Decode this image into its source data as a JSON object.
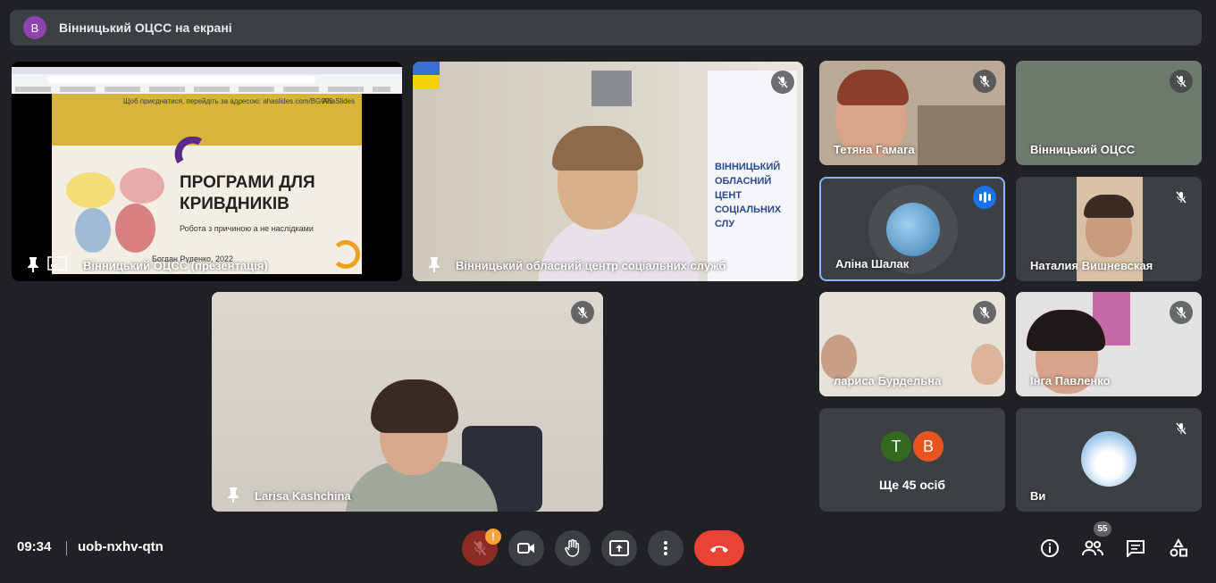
{
  "banner": {
    "avatar_letter": "В",
    "text": "Вінницький ОЦСС на екрані"
  },
  "presentation_tile": {
    "name": "Вінницький ОЦСС (презентація)",
    "slide": {
      "url_line": "Щоб приєднатися, перейдіть за адресою: ahaslides.com/BG995",
      "brand": "AhaSlides",
      "title_line1": "ПРОГРАМИ ДЛЯ",
      "title_line2": "КРИВДНИКІВ",
      "subtitle": "Робота з причиною а не наслідками",
      "author": "Богдан Руденко, 2022"
    }
  },
  "tiles": {
    "center_main": "Вінницький обласний центр соціальних служб",
    "larisa": "Larisa Kashchina",
    "tetiana": "Тетяна Гамага",
    "vinn_ocss": "Вінницький ОЦСС",
    "alina": "Аліна Шалак",
    "natalia": "Наталия Вишневская",
    "larysa_b": "лариса Бурдельна",
    "inga": "Інга Павленко",
    "others": {
      "letters": [
        "Т",
        "В"
      ],
      "label": "Ще 45 осіб"
    },
    "you": "Ви"
  },
  "controls": {
    "time": "09:34",
    "meeting_code": "uob-nxhv-qtn",
    "warning_mark": "!",
    "people_count": "55"
  },
  "colors": {
    "background": "#202124",
    "tile": "#3c4043",
    "active_speaker": "#8ab4f8",
    "hangup": "#ea4335"
  },
  "icons": [
    "pin-icon",
    "mic-off-icon",
    "camera-icon",
    "hand-icon",
    "present-icon",
    "more-icon",
    "hangup-icon",
    "info-icon",
    "people-icon",
    "chat-icon",
    "activities-icon"
  ]
}
